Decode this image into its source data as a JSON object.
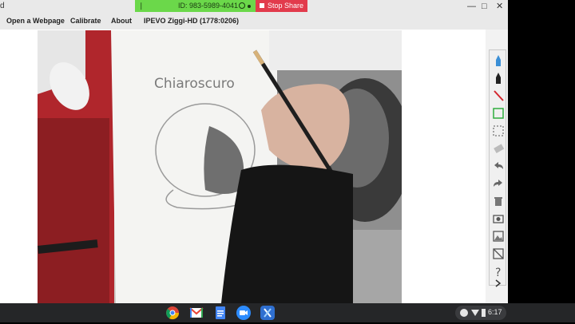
{
  "window": {
    "title_fragment": "d",
    "minimize": "—",
    "maximize": "□",
    "close": "✕"
  },
  "share_bar": {
    "id_text": "ID: 983-5989-4041",
    "stop_label": "Stop Share",
    "color": "#6bd84a",
    "stop_color": "#e23b4c"
  },
  "menu": {
    "items": [
      "Open a Webpage",
      "Calibrate",
      "About",
      "IPEVO Ziggi-HD (1778:0206)"
    ]
  },
  "camera": {
    "handwritten_word": "Chiaroscuro"
  },
  "toolbar": {
    "tools": [
      "highlighter-pen",
      "marker-pen",
      "line",
      "rectangle",
      "select-area",
      "eraser",
      "undo",
      "redo",
      "clear",
      "snapshot",
      "image",
      "background-toggle",
      "help",
      "collapse"
    ]
  },
  "taskbar": {
    "apps": [
      "chrome",
      "gmail",
      "docs",
      "zoom",
      "app"
    ],
    "time": "6:17"
  }
}
